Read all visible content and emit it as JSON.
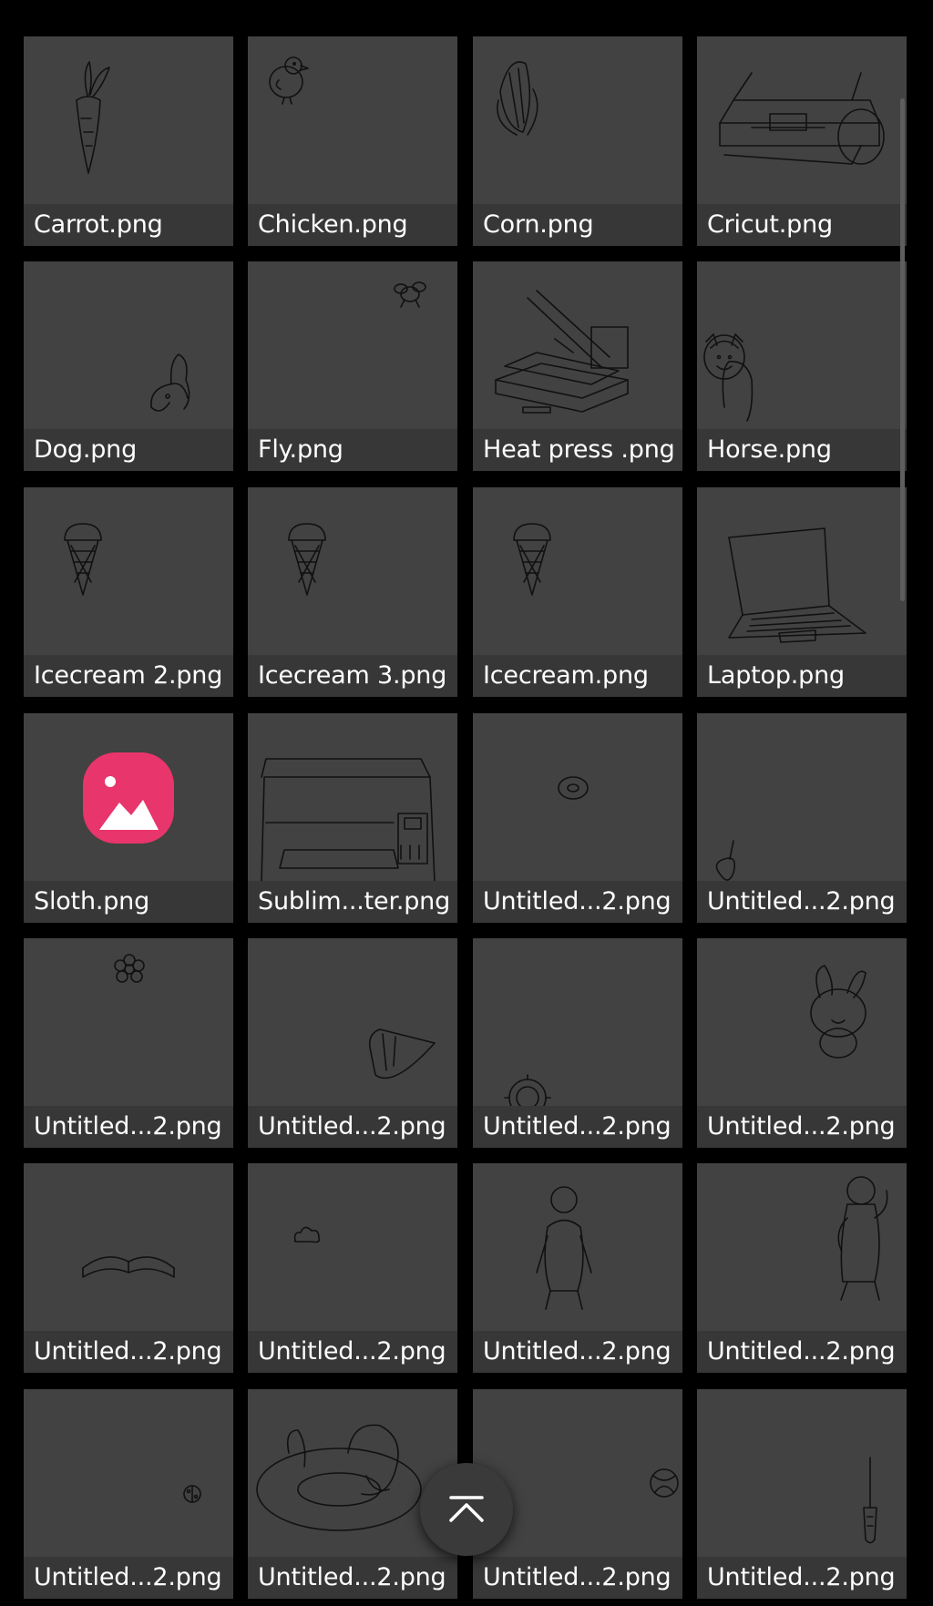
{
  "files": [
    {
      "name": "Carrot.png",
      "icon": "carrot-drawing"
    },
    {
      "name": "Chicken.png",
      "icon": "chick-drawing"
    },
    {
      "name": "Corn.png",
      "icon": "corn-drawing"
    },
    {
      "name": "Cricut.png",
      "icon": "cutting-machine-drawing"
    },
    {
      "name": "Dog.png",
      "icon": "dog-drawing"
    },
    {
      "name": "Fly.png",
      "icon": "fly-drawing"
    },
    {
      "name": "Heat press .png",
      "icon": "heat-press-drawing"
    },
    {
      "name": "Horse.png",
      "icon": "horse-drawing"
    },
    {
      "name": "Icecream 2.png",
      "icon": "icecream-drawing"
    },
    {
      "name": "Icecream 3.png",
      "icon": "icecream-drawing"
    },
    {
      "name": "Icecream.png",
      "icon": "icecream-drawing"
    },
    {
      "name": "Laptop.png",
      "icon": "laptop-drawing"
    },
    {
      "name": "Sloth.png",
      "icon": "gallery-app-icon"
    },
    {
      "name": "Sublim...ter.png",
      "icon": "printer-drawing"
    },
    {
      "name": "Untitled...2.png",
      "icon": "donut-drawing"
    },
    {
      "name": "Untitled...2.png",
      "icon": "cherry-drawing"
    },
    {
      "name": "Untitled...2.png",
      "icon": "flower-drawing"
    },
    {
      "name": "Untitled...2.png",
      "icon": "candy-corn-drawing"
    },
    {
      "name": "Untitled...2.png",
      "icon": "sunflower-drawing"
    },
    {
      "name": "Untitled...2.png",
      "icon": "bunny-drawing"
    },
    {
      "name": "Untitled...2.png",
      "icon": "book-drawing"
    },
    {
      "name": "Untitled...2.png",
      "icon": "cloud-drawing"
    },
    {
      "name": "Untitled...2.png",
      "icon": "figure-drawing"
    },
    {
      "name": "Untitled...2.png",
      "icon": "bear-drawing"
    },
    {
      "name": "Untitled...2.png",
      "icon": "ladybug-drawing"
    },
    {
      "name": "Untitled...2.png",
      "icon": "float-ring-drawing"
    },
    {
      "name": "Untitled...2.png",
      "icon": "ball-drawing"
    },
    {
      "name": "Untitled...2.png",
      "icon": "screwdriver-drawing"
    }
  ],
  "scroll_to_top": {
    "icon": "chevron-up-bar-icon"
  },
  "colors": {
    "background": "#000000",
    "tile": "#424242",
    "label_strip": "#373737",
    "label_text": "#ffffff",
    "gallery_icon": "#e8356b"
  }
}
